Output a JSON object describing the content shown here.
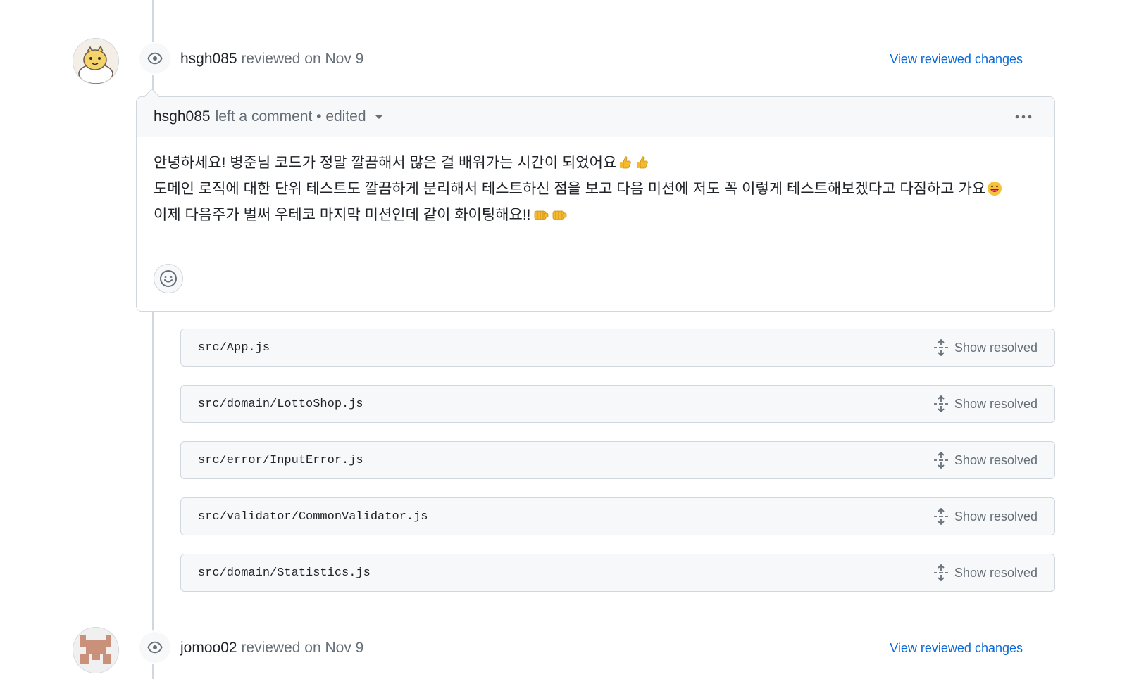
{
  "review_1": {
    "author": "hsgh085",
    "action_text": "reviewed on Nov 9",
    "view_link": "View reviewed changes",
    "comment": {
      "author": "hsgh085",
      "meta": "left a comment • edited",
      "lines": [
        "안녕하세요! 병준님 코드가 정말 깔끔해서 많은 걸 배워가는 시간이 되었어요",
        "도메인 로직에 대한 단위 테스트도 깔끔하게 분리해서 테스트하신 점을 보고 다음 미션에 저도 꼭 이렇게 테스트해보겠다고 다짐하고 가요",
        "이제 다음주가 벌써 우테코 마지막 미션인데 같이 화이팅해요!!"
      ]
    },
    "files": [
      {
        "path": "src/App.js",
        "action": "Show resolved"
      },
      {
        "path": "src/domain/LottoShop.js",
        "action": "Show resolved"
      },
      {
        "path": "src/error/InputError.js",
        "action": "Show resolved"
      },
      {
        "path": "src/validator/CommonValidator.js",
        "action": "Show resolved"
      },
      {
        "path": "src/domain/Statistics.js",
        "action": "Show resolved"
      }
    ]
  },
  "review_2": {
    "author": "jomoo02",
    "action_text": "reviewed on Nov 9",
    "view_link": "View reviewed changes"
  },
  "icons": [
    "eye-icon",
    "kebab-icon",
    "caret-down-icon",
    "smiley-icon",
    "unfold-icon",
    "thumbs-up-emoji",
    "grinning-emoji",
    "fist-bump-emoji"
  ],
  "colors": {
    "link": "#0969da",
    "muted": "#656d76",
    "border": "#d0d7de",
    "subtle_bg": "#f6f8fa"
  }
}
